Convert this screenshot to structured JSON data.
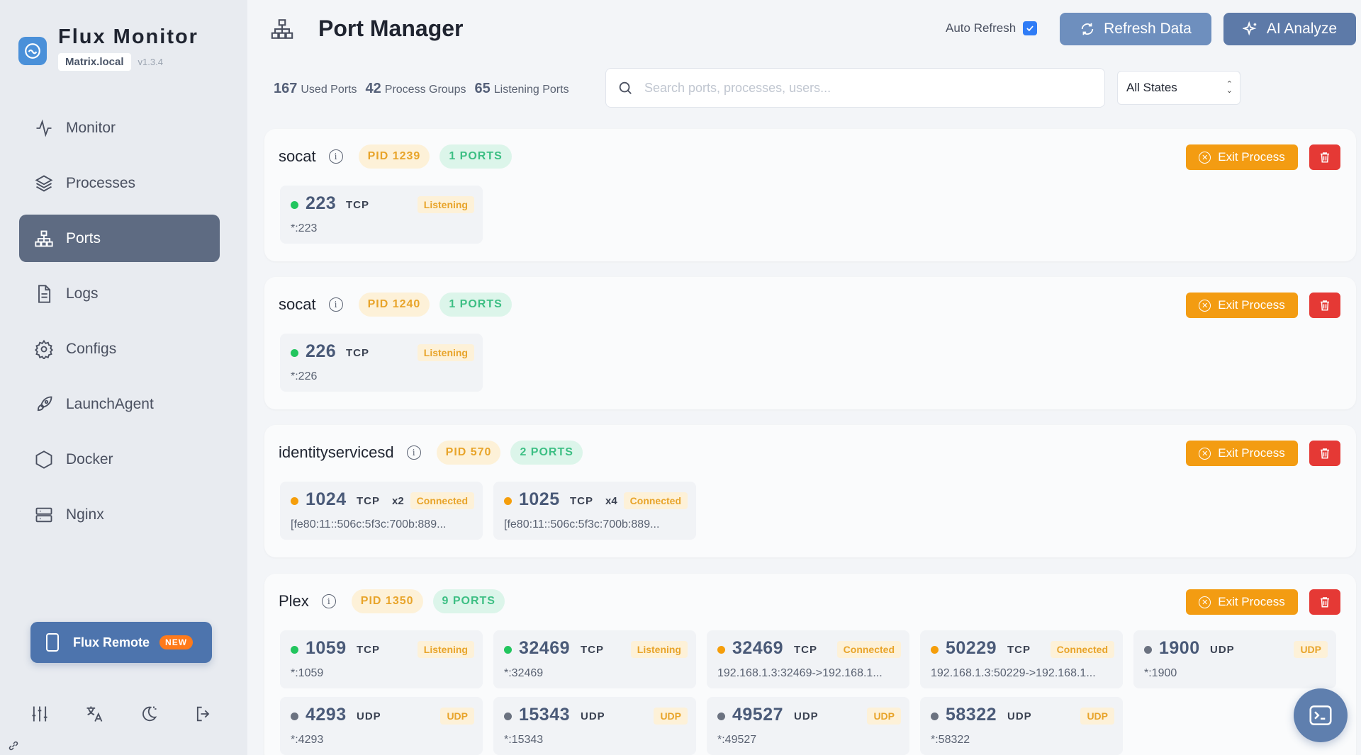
{
  "app": {
    "title": "Flux Monitor",
    "host": "Matrix.local",
    "version": "v1.3.4"
  },
  "sidebar": {
    "items": [
      {
        "label": "Monitor",
        "icon": "activity-icon",
        "active": false
      },
      {
        "label": "Processes",
        "icon": "layers-icon",
        "active": false
      },
      {
        "label": "Ports",
        "icon": "network-icon",
        "active": true
      },
      {
        "label": "Logs",
        "icon": "document-icon",
        "active": false
      },
      {
        "label": "Configs",
        "icon": "gear-icon",
        "active": false
      },
      {
        "label": "LaunchAgent",
        "icon": "rocket-icon",
        "active": false
      },
      {
        "label": "Docker",
        "icon": "hexagon-icon",
        "active": false
      },
      {
        "label": "Nginx",
        "icon": "server-icon",
        "active": false
      }
    ],
    "remote": {
      "label": "Flux Remote",
      "badge": "NEW"
    }
  },
  "header": {
    "title": "Port Manager",
    "auto_refresh_label": "Auto Refresh",
    "auto_refresh_checked": true,
    "refresh_label": "Refresh Data",
    "ai_label": "AI Analyze"
  },
  "stats": {
    "used_ports": "167",
    "used_ports_label": "Used Ports",
    "process_groups": "42",
    "process_groups_label": "Process Groups",
    "listening_ports": "65",
    "listening_ports_label": "Listening Ports"
  },
  "search": {
    "placeholder": "Search ports, processes, users...",
    "value": ""
  },
  "filter": {
    "selected": "All States"
  },
  "actions": {
    "exit_label": "Exit Process"
  },
  "colors": {
    "accent": "#5e6b82",
    "exit": "#f39c12",
    "delete": "#e53935",
    "listening": "#22c55e",
    "connected": "#f59e0b",
    "udp": "#6b7280"
  },
  "processes": [
    {
      "name": "socat",
      "pid": "PID 1239",
      "ports_count": "1 PORTS",
      "ports": [
        {
          "port": "223",
          "proto": "TCP",
          "mult": "",
          "state": "Listening",
          "addr": "*:223",
          "dot": "green"
        }
      ]
    },
    {
      "name": "socat",
      "pid": "PID 1240",
      "ports_count": "1 PORTS",
      "ports": [
        {
          "port": "226",
          "proto": "TCP",
          "mult": "",
          "state": "Listening",
          "addr": "*:226",
          "dot": "green"
        }
      ]
    },
    {
      "name": "identityservicesd",
      "pid": "PID 570",
      "ports_count": "2 PORTS",
      "ports": [
        {
          "port": "1024",
          "proto": "TCP",
          "mult": "x2",
          "state": "Connected",
          "addr": "[fe80:11::506c:5f3c:700b:889...",
          "dot": "orange"
        },
        {
          "port": "1025",
          "proto": "TCP",
          "mult": "x4",
          "state": "Connected",
          "addr": "[fe80:11::506c:5f3c:700b:889...",
          "dot": "orange"
        }
      ]
    },
    {
      "name": "Plex",
      "pid": "PID 1350",
      "ports_count": "9 PORTS",
      "ports": [
        {
          "port": "1059",
          "proto": "TCP",
          "mult": "",
          "state": "Listening",
          "addr": "*:1059",
          "dot": "green"
        },
        {
          "port": "32469",
          "proto": "TCP",
          "mult": "",
          "state": "Listening",
          "addr": "*:32469",
          "dot": "green"
        },
        {
          "port": "32469",
          "proto": "TCP",
          "mult": "",
          "state": "Connected",
          "addr": "192.168.1.3:32469->192.168.1...",
          "dot": "orange"
        },
        {
          "port": "50229",
          "proto": "TCP",
          "mult": "",
          "state": "Connected",
          "addr": "192.168.1.3:50229->192.168.1...",
          "dot": "orange"
        },
        {
          "port": "1900",
          "proto": "UDP",
          "mult": "",
          "state": "UDP",
          "addr": "*:1900",
          "dot": "gray"
        },
        {
          "port": "4293",
          "proto": "UDP",
          "mult": "",
          "state": "UDP",
          "addr": "*:4293",
          "dot": "gray"
        },
        {
          "port": "15343",
          "proto": "UDP",
          "mult": "",
          "state": "UDP",
          "addr": "*:15343",
          "dot": "gray"
        },
        {
          "port": "49527",
          "proto": "UDP",
          "mult": "",
          "state": "UDP",
          "addr": "*:49527",
          "dot": "gray"
        },
        {
          "port": "58322",
          "proto": "UDP",
          "mult": "",
          "state": "UDP",
          "addr": "*:58322",
          "dot": "gray"
        }
      ]
    }
  ]
}
